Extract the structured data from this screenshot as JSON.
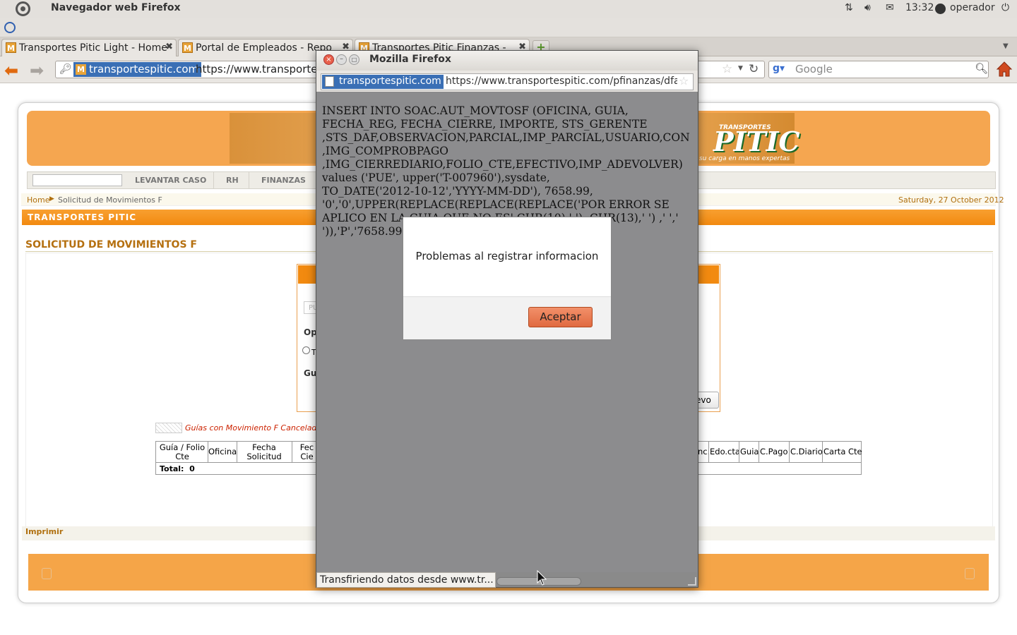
{
  "os": {
    "window_title": "Navegador web Firefox",
    "time": "13:32",
    "user": "operador"
  },
  "tabs": [
    {
      "label": "Transportes Pitic Light - Home"
    },
    {
      "label": "Portal de Empleados - Repo"
    },
    {
      "label": "Transportes Pitic Finanzas -"
    }
  ],
  "navbar": {
    "site_identity": "transportespitic.com",
    "url": "https://www.transportes",
    "search_placeholder": "Google"
  },
  "site": {
    "logo_text": "PITIC",
    "logo_small": "TRANSPORTES",
    "logo_slogan": "su carga en manos expertas",
    "menu": [
      "LEVANTAR CASO",
      "RH",
      "FINANZAS"
    ],
    "breadcrumb_home": "Home",
    "breadcrumb_page": "Solicitud de Movimientos F",
    "date": "Saturday, 27 October 2012",
    "bar_title": "TRANSPORTES PITIC",
    "section_title": "SOLICITUD DE MOVIMIENTOS F",
    "form": {
      "input_partial": "PU",
      "label_op": "Op",
      "radio_partial": "T",
      "label_gu": "Gu",
      "button_partial": "evo"
    },
    "legend_text": "Guías con Movimiento F Canceladas",
    "table": {
      "headers_left": [
        "Guía / Folio Cte",
        "Oficina",
        "Fecha Solicitud",
        "Fec Cie"
      ],
      "headers_right": [
        "nc.",
        "Edo.cta",
        "Guia",
        "C.Pago",
        "C.Diario",
        "Carta Cte"
      ],
      "total_label": "Total:",
      "total_value": "0"
    },
    "print_link": "Imprimir"
  },
  "popup": {
    "title": "Mozilla Firefox",
    "site_identity": "transportespitic.com",
    "url": "https://www.transportespitic.com/pfinanzas/dfa",
    "sql_text": "INSERT INTO SOAC.AUT_MOVTOSF (OFICINA, GUIA,\nFECHA_REG, FECHA_CIERRE, IMPORTE, STS_GERENTE\n,STS_DAF,OBSERVACION,PARCIAL,IMP_PARCIAL,USUARIO,CON\n,IMG_COMPROBPAGO\n,IMG_CIERREDIARIO,FOLIO_CTE,EFECTIVO,IMP_ADEVOLVER)\nvalues ('PUE', upper('T-007960'),sysdate,\nTO_DATE('2012-10-12','YYYY-MM-DD'), 7658.99,\n'0','0',UPPER(REPLACE(REPLACE(REPLACE('POR ERROR SE\nAPLICO EN LA GUIA QUE NO ES',CHR(10),' '), CHR(13),' ') ,' ','\n')),'P','7658.99",
    "status": "Transfiriendo datos desde www.tr..."
  },
  "alert": {
    "message": "Problemas al registrar informacion",
    "ok_label": "Aceptar"
  }
}
